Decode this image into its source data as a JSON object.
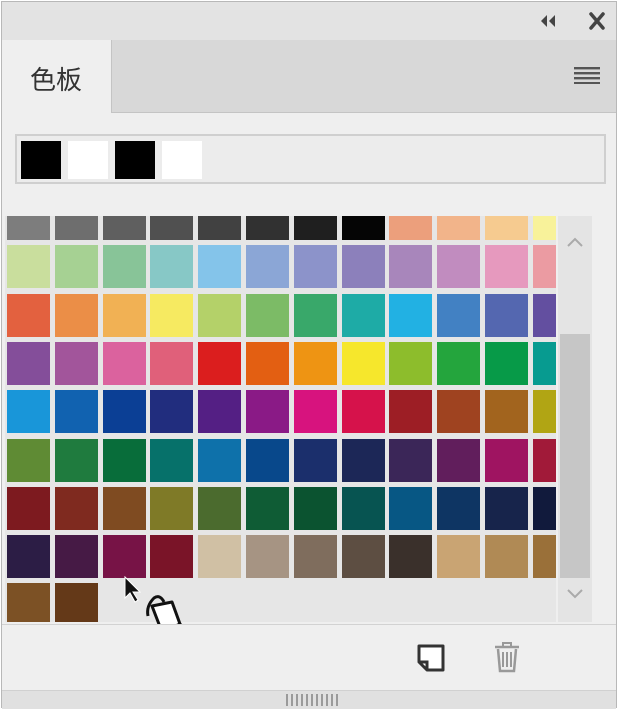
{
  "panel": {
    "tab_label": "色板",
    "icons": {
      "collapse": "double-chevron-left-icon",
      "close": "close-icon",
      "menu": "hamburger-menu-icon",
      "new_swatch": "new-swatch-icon",
      "delete": "trash-icon",
      "grip": "resize-grip-icon"
    }
  },
  "recent_colors": [
    "#000000",
    "#ffffff",
    "#000000",
    "#ffffff"
  ],
  "swatch_rows": [
    [
      "#7d7d7d",
      "#6e6e6e",
      "#5f5f5f",
      "#505050",
      "#414141",
      "#313131",
      "#1f1f1f",
      "#050505",
      "#ec9f7c",
      "#f2b48a",
      "#f6cb90",
      "#f8f29a"
    ],
    [
      "#c9de9d",
      "#a6d193",
      "#88c498",
      "#87c8c6",
      "#84c4ea",
      "#8ba6d6",
      "#8c93ca",
      "#8c80bb",
      "#a886bb",
      "#c18cbf",
      "#e699be",
      "#eb9ba2"
    ],
    [
      "#e3613f",
      "#eb8e47",
      "#f1b154",
      "#f6ea61",
      "#b4d169",
      "#7cbb66",
      "#39a86a",
      "#1eaba6",
      "#22b1e3",
      "#4281c3",
      "#5467b0",
      "#634fa0"
    ],
    [
      "#844e9a",
      "#a2559b",
      "#db629e",
      "#e0607a",
      "#db1e1e",
      "#e35f12",
      "#ee9413",
      "#f6e72c",
      "#8dbd2c",
      "#24a53d",
      "#079a48",
      "#079b90"
    ],
    [
      "#1996d9",
      "#1162b0",
      "#0b3f95",
      "#212d7e",
      "#541f84",
      "#8a1a86",
      "#d7137e",
      "#d6124b",
      "#9d1e25",
      "#9f4320",
      "#a2641e",
      "#b1a514"
    ],
    [
      "#5f8b34",
      "#1f7b3e",
      "#086d3a",
      "#06716a",
      "#0e71aa",
      "#08488b",
      "#1b2f6c",
      "#1c2757",
      "#3b2658",
      "#611e5c",
      "#9f1461",
      "#a11a39"
    ],
    [
      "#7d1a1f",
      "#7f2a1f",
      "#7f4b21",
      "#7f7a27",
      "#4b6b2e",
      "#0f5c35",
      "#0b5330",
      "#075451",
      "#075784",
      "#0e3563",
      "#17244b",
      "#111a3c"
    ],
    [
      "#2c1d45",
      "#461a45",
      "#771346",
      "#7a1428",
      "#d0c0a4",
      "#a69483",
      "#7f6d5d",
      "#5d4e42",
      "#3a302b",
      "#c9a473",
      "#b08a55",
      "#9a7039"
    ],
    [
      "#7c5125",
      "#643918"
    ]
  ]
}
